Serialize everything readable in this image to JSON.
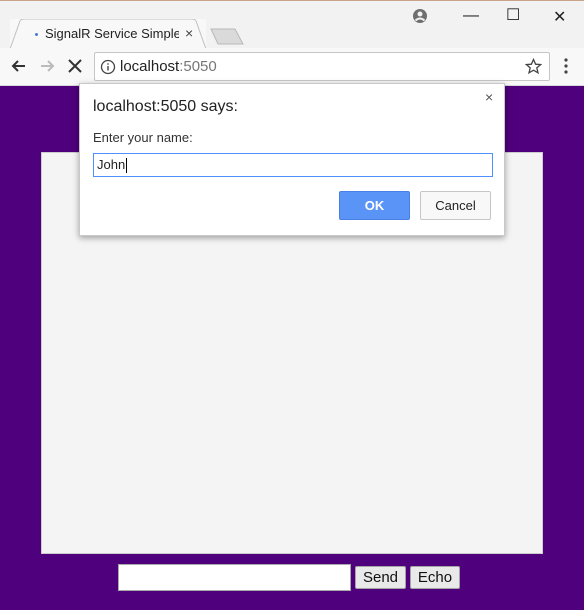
{
  "browser": {
    "tab_title": "SignalR Service Simple",
    "tab_close_glyph": "×",
    "window_controls": {
      "minimize": "—",
      "maximize": "☐",
      "close": "✕"
    },
    "address": {
      "host": "localhost",
      "port": ":5050"
    }
  },
  "dialog": {
    "title": "localhost:5050 says:",
    "close_glyph": "×",
    "label": "Enter your name:",
    "input_value": "John",
    "ok_label": "OK",
    "cancel_label": "Cancel"
  },
  "page": {
    "message_input_value": "",
    "send_label": "Send",
    "echo_label": "Echo"
  },
  "colors": {
    "page_background": "#4f007c",
    "message_area": "#f4f4f4",
    "ok_button": "#5b94f7"
  },
  "icons": [
    "favicon-icon",
    "close-icon",
    "new-tab-icon",
    "profile-icon",
    "minimize-icon",
    "maximize-icon",
    "back-icon",
    "forward-icon",
    "stop-icon",
    "info-icon",
    "star-icon",
    "menu-icon"
  ]
}
